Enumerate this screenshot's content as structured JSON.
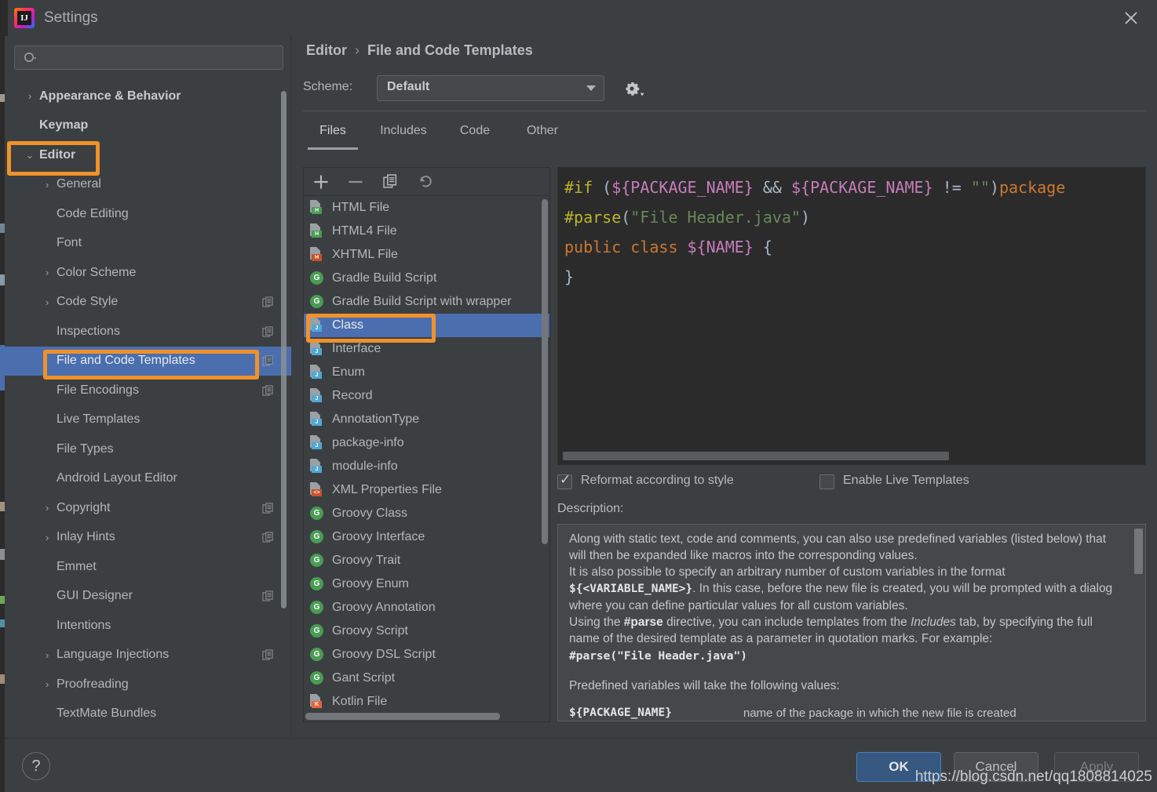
{
  "window": {
    "title": "Settings",
    "logo_text": "IJ",
    "close_icon": "✕"
  },
  "search": {
    "placeholder": "",
    "value": "",
    "icon": "search-icon"
  },
  "sidebar": {
    "items": [
      {
        "label": "Appearance & Behavior",
        "arrow": "›",
        "indent": 0,
        "bold": true,
        "badge": false,
        "selected": false
      },
      {
        "label": "Keymap",
        "arrow": "",
        "indent": 0,
        "bold": true,
        "badge": false,
        "selected": false
      },
      {
        "label": "Editor",
        "arrow": "⌄",
        "indent": 0,
        "bold": true,
        "badge": false,
        "selected": false
      },
      {
        "label": "General",
        "arrow": "›",
        "indent": 1,
        "bold": false,
        "badge": false,
        "selected": false
      },
      {
        "label": "Code Editing",
        "arrow": "",
        "indent": 1,
        "bold": false,
        "badge": false,
        "selected": false
      },
      {
        "label": "Font",
        "arrow": "",
        "indent": 1,
        "bold": false,
        "badge": false,
        "selected": false
      },
      {
        "label": "Color Scheme",
        "arrow": "›",
        "indent": 1,
        "bold": false,
        "badge": false,
        "selected": false
      },
      {
        "label": "Code Style",
        "arrow": "›",
        "indent": 1,
        "bold": false,
        "badge": true,
        "selected": false
      },
      {
        "label": "Inspections",
        "arrow": "",
        "indent": 1,
        "bold": false,
        "badge": true,
        "selected": false
      },
      {
        "label": "File and Code Templates",
        "arrow": "",
        "indent": 1,
        "bold": false,
        "badge": true,
        "selected": true
      },
      {
        "label": "File Encodings",
        "arrow": "",
        "indent": 1,
        "bold": false,
        "badge": true,
        "selected": false
      },
      {
        "label": "Live Templates",
        "arrow": "",
        "indent": 1,
        "bold": false,
        "badge": false,
        "selected": false
      },
      {
        "label": "File Types",
        "arrow": "",
        "indent": 1,
        "bold": false,
        "badge": false,
        "selected": false
      },
      {
        "label": "Android Layout Editor",
        "arrow": "",
        "indent": 1,
        "bold": false,
        "badge": false,
        "selected": false
      },
      {
        "label": "Copyright",
        "arrow": "›",
        "indent": 1,
        "bold": false,
        "badge": true,
        "selected": false
      },
      {
        "label": "Inlay Hints",
        "arrow": "›",
        "indent": 1,
        "bold": false,
        "badge": true,
        "selected": false
      },
      {
        "label": "Emmet",
        "arrow": "",
        "indent": 1,
        "bold": false,
        "badge": false,
        "selected": false
      },
      {
        "label": "GUI Designer",
        "arrow": "",
        "indent": 1,
        "bold": false,
        "badge": true,
        "selected": false
      },
      {
        "label": "Intentions",
        "arrow": "",
        "indent": 1,
        "bold": false,
        "badge": false,
        "selected": false
      },
      {
        "label": "Language Injections",
        "arrow": "›",
        "indent": 1,
        "bold": false,
        "badge": true,
        "selected": false
      },
      {
        "label": "Proofreading",
        "arrow": "›",
        "indent": 1,
        "bold": false,
        "badge": false,
        "selected": false
      },
      {
        "label": "TextMate Bundles",
        "arrow": "",
        "indent": 1,
        "bold": false,
        "badge": false,
        "selected": false
      }
    ]
  },
  "breadcrumb": {
    "parent": "Editor",
    "separator": "›",
    "current": "File and Code Templates"
  },
  "scheme": {
    "label": "Scheme:",
    "value": "Default",
    "gear_icon": "gear-icon"
  },
  "tabs": [
    {
      "label": "Files",
      "active": true
    },
    {
      "label": "Includes",
      "active": false
    },
    {
      "label": "Code",
      "active": false
    },
    {
      "label": "Other",
      "active": false
    }
  ],
  "list_toolbar": [
    {
      "name": "add-template-button",
      "icon": "plus-icon",
      "glyph": "＋",
      "dim": false
    },
    {
      "name": "remove-template-button",
      "icon": "minus-icon",
      "glyph": "－",
      "dim": true
    },
    {
      "name": "copy-template-button",
      "icon": "copy-icon",
      "glyph": "",
      "dim": false
    },
    {
      "name": "reset-template-button",
      "icon": "undo-icon",
      "glyph": "↺",
      "dim": true
    }
  ],
  "templates": [
    {
      "label": "HTML File",
      "icon": "html-file-icon",
      "kind": "file",
      "tag": "H",
      "color": "#499c54",
      "selected": false
    },
    {
      "label": "HTML4 File",
      "icon": "html4-file-icon",
      "kind": "file",
      "tag": "H",
      "color": "#499c54",
      "selected": false
    },
    {
      "label": "XHTML File",
      "icon": "xhtml-file-icon",
      "kind": "file",
      "tag": "H",
      "color": "#c75226",
      "selected": false
    },
    {
      "label": "Gradle Build Script",
      "icon": "groovy-icon",
      "kind": "circle",
      "tag": "G",
      "color": "#499c54",
      "selected": false
    },
    {
      "label": "Gradle Build Script with wrapper",
      "icon": "groovy-icon",
      "kind": "circle",
      "tag": "G",
      "color": "#499c54",
      "selected": false
    },
    {
      "label": "Class",
      "icon": "java-class-icon",
      "kind": "file",
      "tag": "J",
      "color": "#52a7d4",
      "selected": true
    },
    {
      "label": "Interface",
      "icon": "java-interface-icon",
      "kind": "file",
      "tag": "J",
      "color": "#52a7d4",
      "selected": false
    },
    {
      "label": "Enum",
      "icon": "java-enum-icon",
      "kind": "file",
      "tag": "J",
      "color": "#52a7d4",
      "selected": false
    },
    {
      "label": "Record",
      "icon": "java-record-icon",
      "kind": "file",
      "tag": "J",
      "color": "#52a7d4",
      "selected": false
    },
    {
      "label": "AnnotationType",
      "icon": "java-annotation-icon",
      "kind": "file",
      "tag": "J",
      "color": "#52a7d4",
      "selected": false
    },
    {
      "label": "package-info",
      "icon": "java-package-icon",
      "kind": "file",
      "tag": "J",
      "color": "#52a7d4",
      "selected": false
    },
    {
      "label": "module-info",
      "icon": "java-module-icon",
      "kind": "file",
      "tag": "J",
      "color": "#52a7d4",
      "selected": false
    },
    {
      "label": "XML Properties File",
      "icon": "xml-file-icon",
      "kind": "file",
      "tag": "<>",
      "color": "#c75226",
      "selected": false
    },
    {
      "label": "Groovy Class",
      "icon": "groovy-icon",
      "kind": "circle",
      "tag": "G",
      "color": "#499c54",
      "selected": false
    },
    {
      "label": "Groovy Interface",
      "icon": "groovy-icon",
      "kind": "circle",
      "tag": "G",
      "color": "#499c54",
      "selected": false
    },
    {
      "label": "Groovy Trait",
      "icon": "groovy-icon",
      "kind": "circle",
      "tag": "G",
      "color": "#499c54",
      "selected": false
    },
    {
      "label": "Groovy Enum",
      "icon": "groovy-icon",
      "kind": "circle",
      "tag": "G",
      "color": "#499c54",
      "selected": false
    },
    {
      "label": "Groovy Annotation",
      "icon": "groovy-icon",
      "kind": "circle",
      "tag": "G",
      "color": "#499c54",
      "selected": false
    },
    {
      "label": "Groovy Script",
      "icon": "groovy-icon",
      "kind": "circle",
      "tag": "G",
      "color": "#499c54",
      "selected": false
    },
    {
      "label": "Groovy DSL Script",
      "icon": "groovy-icon",
      "kind": "circle",
      "tag": "G",
      "color": "#499c54",
      "selected": false
    },
    {
      "label": "Gant Script",
      "icon": "groovy-icon",
      "kind": "circle",
      "tag": "G",
      "color": "#499c54",
      "selected": false
    },
    {
      "label": "Kotlin File",
      "icon": "kotlin-file-icon",
      "kind": "file",
      "tag": "K",
      "color": "#e2673a",
      "selected": false
    }
  ],
  "editor": {
    "lines": [
      [
        {
          "t": "#if ",
          "c": "dir"
        },
        {
          "t": "(",
          "c": "op"
        },
        {
          "t": "${PACKAGE_NAME}",
          "c": "var"
        },
        {
          "t": " && ",
          "c": "op"
        },
        {
          "t": "${PACKAGE_NAME}",
          "c": "var"
        },
        {
          "t": " != ",
          "c": "op"
        },
        {
          "t": "\"\"",
          "c": "str"
        },
        {
          "t": ")",
          "c": "op"
        },
        {
          "t": "package",
          "c": "kw"
        }
      ],
      [
        {
          "t": "#parse",
          "c": "dir"
        },
        {
          "t": "(",
          "c": "op"
        },
        {
          "t": "\"File Header.java\"",
          "c": "str"
        },
        {
          "t": ")",
          "c": "op"
        }
      ],
      [
        {
          "t": "public class ",
          "c": "kw"
        },
        {
          "t": "${NAME}",
          "c": "var"
        },
        {
          "t": " {",
          "c": "op"
        }
      ],
      [
        {
          "t": "}",
          "c": "op"
        }
      ]
    ]
  },
  "options": {
    "reformat": {
      "label": "Reformat according to style",
      "checked": true
    },
    "live_templates": {
      "label": "Enable Live Templates",
      "checked": false
    }
  },
  "description": {
    "label": "Description:",
    "paragraph1_a": "Along with static text, code and comments, you can also use predefined variables (listed below) that will then be expanded like macros into the corresponding values.",
    "paragraph1_b": "It is also possible to specify an arbitrary number of custom variables in the format ",
    "variable_format": "${<VARIABLE_NAME>}",
    "paragraph1_c": ". In this case, before the new file is created, you will be prompted with a dialog where you can define particular values for all custom variables.",
    "paragraph2_a": "Using the ",
    "parse_keyword": "#parse",
    "paragraph2_b": " directive, you can include templates from the ",
    "includes_tab": "Includes",
    "paragraph2_c": " tab, by specifying the full name of the desired template as a parameter in quotation marks. For example:",
    "parse_example": "#parse(\"File Header.java\")",
    "paragraph3": "Predefined variables will take the following values:",
    "vars": [
      {
        "name": "${PACKAGE_NAME}",
        "desc": "name of the package in which the new file is created"
      }
    ]
  },
  "buttons": {
    "ok": "OK",
    "cancel": "Cancel",
    "apply": "Apply",
    "help": "?"
  },
  "watermark": "https://blog.csdn.net/qq1808814025",
  "colors": {
    "accent_selection": "#4b6eaf",
    "annotation": "#f0922b",
    "primary_button": "#365880",
    "window_bg": "#3c3f41",
    "editor_bg": "#2b2b2b"
  }
}
